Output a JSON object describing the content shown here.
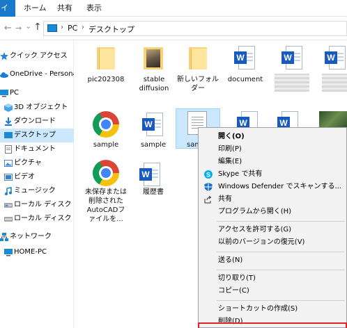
{
  "ribbon": {
    "file_tab": "イル",
    "tabs": [
      "ホーム",
      "共有",
      "表示"
    ]
  },
  "address": {
    "path": [
      "PC",
      "デスクトップ"
    ],
    "separator": "›"
  },
  "nav": {
    "back": "←",
    "forward": "→",
    "dropdown": "⌄",
    "up": "↑"
  },
  "sidebar": {
    "items": [
      {
        "label": "クイック アクセス",
        "icon": "star-icon"
      },
      {
        "label": "OneDrive - Personal",
        "icon": "cloud-icon"
      },
      {
        "label": "PC",
        "icon": "pc-icon"
      },
      {
        "label": "3D オブジェクト",
        "icon": "cube-icon"
      },
      {
        "label": "ダウンロード",
        "icon": "download-icon"
      },
      {
        "label": "デスクトップ",
        "icon": "desktop-icon"
      },
      {
        "label": "ドキュメント",
        "icon": "document-icon"
      },
      {
        "label": "ピクチャ",
        "icon": "picture-icon"
      },
      {
        "label": "ビデオ",
        "icon": "video-icon"
      },
      {
        "label": "ミュージック",
        "icon": "music-icon"
      },
      {
        "label": "ローカル ディスク (C:)",
        "icon": "drive-icon"
      },
      {
        "label": "ローカル ディスク (D:)",
        "icon": "drive-icon"
      },
      {
        "label": "ネットワーク",
        "icon": "network-icon"
      },
      {
        "label": "HOME-PC",
        "icon": "computer-icon"
      }
    ]
  },
  "files": [
    {
      "label": "pic202308",
      "icon": "folder-icon"
    },
    {
      "label": "stable diffusion",
      "icon": "folder-image-icon"
    },
    {
      "label": "新しいフォルダー",
      "icon": "folder-icon"
    },
    {
      "label": "document",
      "icon": "word-icon"
    },
    {
      "label": "sample",
      "icon": "chrome-icon"
    },
    {
      "label": "sample",
      "icon": "word-icon"
    },
    {
      "label": "sam",
      "icon": "text-file-icon"
    },
    {
      "label": "未保存または削除されたAutoCADファイルを...",
      "icon": "chrome-icon"
    },
    {
      "label": "履歴書",
      "icon": "word-icon"
    }
  ],
  "context_menu": {
    "items": [
      {
        "label": "開く(O)",
        "icon": ""
      },
      {
        "label": "印刷(P)",
        "icon": ""
      },
      {
        "label": "編集(E)",
        "icon": ""
      },
      {
        "label": "Skype で共有",
        "icon": "skype-icon"
      },
      {
        "label": "Windows Defender でスキャンする...",
        "icon": "defender-icon"
      },
      {
        "label": "共有",
        "icon": "share-icon"
      },
      {
        "label": "プログラムから開く(H)",
        "icon": ""
      },
      {
        "label": "アクセスを許可する(G)",
        "icon": ""
      },
      {
        "label": "以前のバージョンの復元(V)",
        "icon": ""
      },
      {
        "label": "送る(N)",
        "icon": ""
      },
      {
        "label": "切り取り(T)",
        "icon": ""
      },
      {
        "label": "コピー(C)",
        "icon": ""
      },
      {
        "label": "ショートカットの作成(S)",
        "icon": ""
      },
      {
        "label": "削除(D)",
        "icon": ""
      }
    ]
  },
  "colors": {
    "accent": "#1979ca",
    "selection": "#cce8ff",
    "highlight_box": "#e0242c",
    "word_blue": "#185abd"
  }
}
